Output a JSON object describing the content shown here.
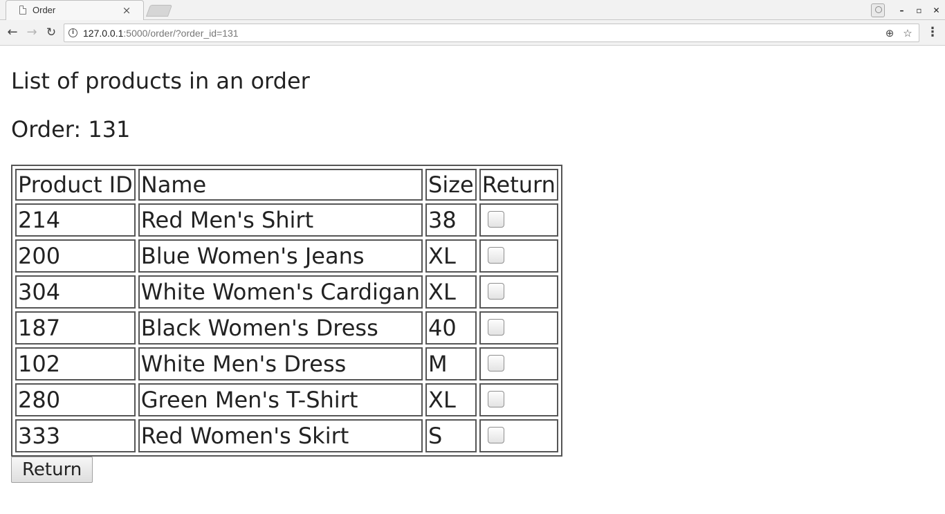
{
  "browser": {
    "tab_title": "Order",
    "tab_close": "×",
    "url_host": "127.0.0.1",
    "url_rest": ":5000/order/?order_id=131",
    "icons": {
      "back": "arrow-left-icon",
      "forward": "arrow-right-icon",
      "reload": "reload-icon",
      "info": "info-icon",
      "zoom": "zoom-icon",
      "bookmark": "star-icon",
      "menu": "kebab-menu-icon"
    }
  },
  "page": {
    "heading": "List of products in an order",
    "order_label": "Order: 131"
  },
  "table": {
    "headers": [
      "Product ID",
      "Name",
      "Size",
      "Return"
    ],
    "rows": [
      {
        "id": "214",
        "name": "Red Men's Shirt",
        "size": "38",
        "return_checked": false
      },
      {
        "id": "200",
        "name": "Blue Women's Jeans",
        "size": "XL",
        "return_checked": false
      },
      {
        "id": "304",
        "name": "White Women's Cardigan",
        "size": "XL",
        "return_checked": false
      },
      {
        "id": "187",
        "name": "Black Women's Dress",
        "size": "40",
        "return_checked": false
      },
      {
        "id": "102",
        "name": "White Men's Dress",
        "size": "M",
        "return_checked": false
      },
      {
        "id": "280",
        "name": "Green Men's T-Shirt",
        "size": "XL",
        "return_checked": false
      },
      {
        "id": "333",
        "name": "Red Women's Skirt",
        "size": "S",
        "return_checked": false
      }
    ]
  },
  "actions": {
    "return_label": "Return"
  }
}
